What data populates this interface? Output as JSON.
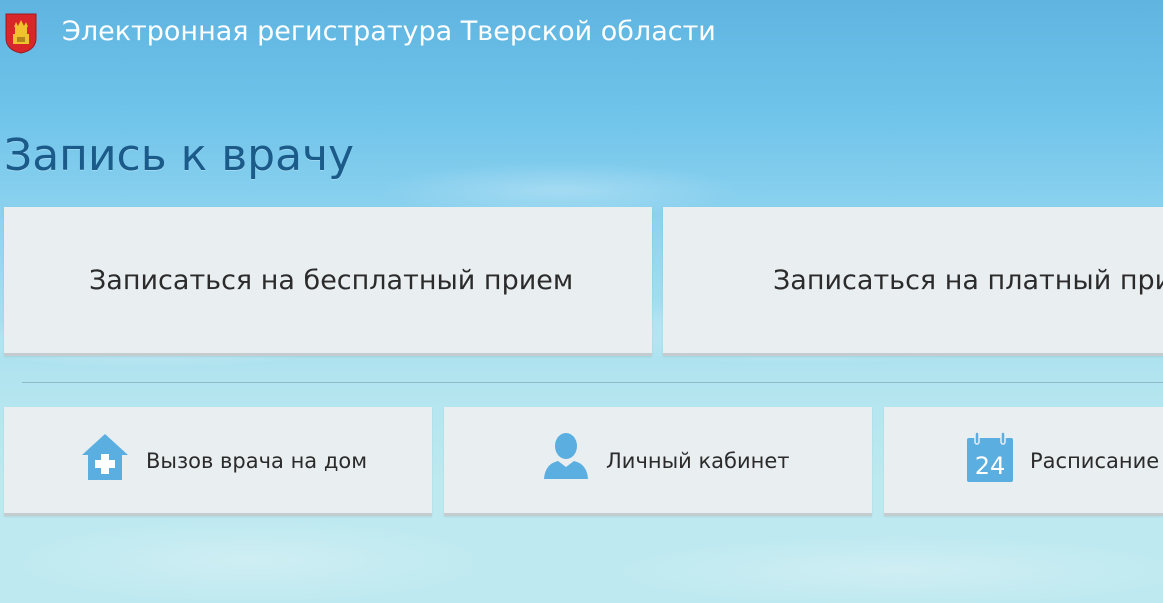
{
  "header": {
    "logo_icon": "tver-coat-of-arms-icon",
    "title": "Электронная регистратура Тверской области"
  },
  "page_title": "Запись к врачу",
  "main_actions": [
    {
      "label": "Записаться на бесплатный прием"
    },
    {
      "label": "Записаться на платный при"
    }
  ],
  "secondary_actions": [
    {
      "label": "Вызов врача на дом",
      "icon": "house-plus-icon"
    },
    {
      "label": "Личный кабинет",
      "icon": "user-icon"
    },
    {
      "label": "Расписание",
      "icon": "calendar-icon",
      "icon_text": "24"
    }
  ],
  "colors": {
    "icon_blue": "#5aaee0",
    "title_blue": "#1b5b8a",
    "tile_bg": "#e9eef1"
  }
}
